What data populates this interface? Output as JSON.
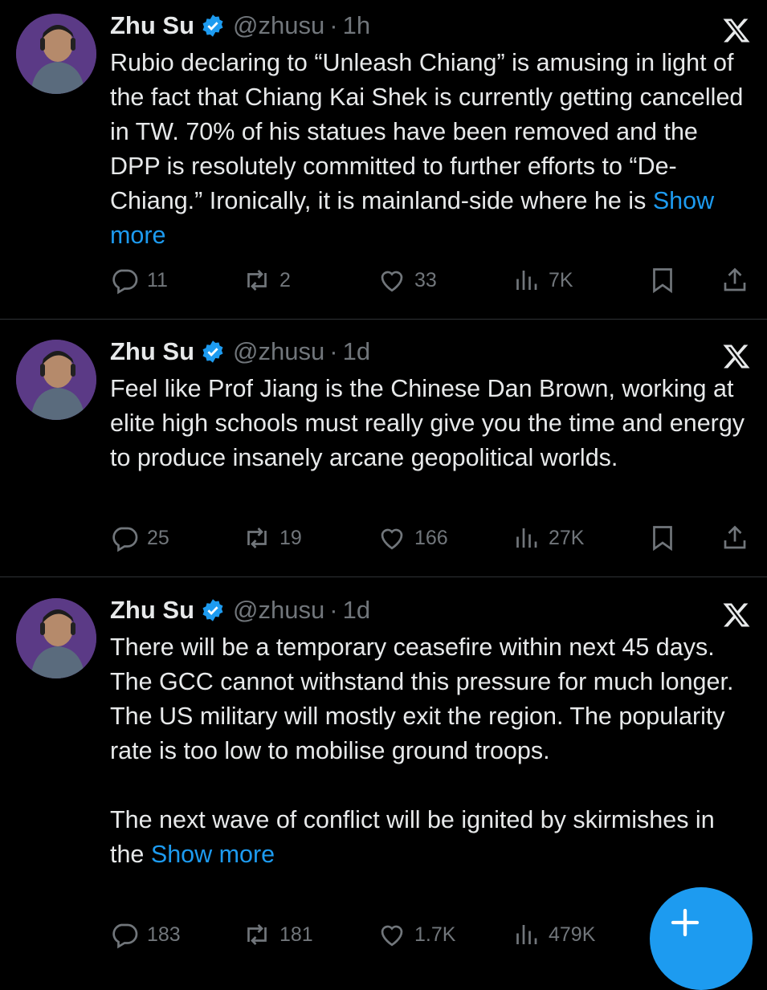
{
  "tweets": [
    {
      "author": "Zhu Su",
      "handle": "@zhusu",
      "separator": "·",
      "time": "1h",
      "text": "Rubio declaring to “Unleash Chiang” is amusing in light of the fact that Chiang Kai Shek is currently getting cancelled in TW. 70% of his statues have been removed and the DPP is resolutely committed to further efforts to “De-Chiang.” Ironically, it is mainland-side where he is ",
      "show_more": "Show more",
      "replies": "11",
      "reposts": "2",
      "likes": "33",
      "views": "7K"
    },
    {
      "author": "Zhu Su",
      "handle": "@zhusu",
      "separator": "·",
      "time": "1d",
      "text": "Feel like Prof Jiang is the Chinese Dan Brown, working at elite high schools must really give you the time and energy to produce insanely arcane geopolitical worlds.",
      "replies": "25",
      "reposts": "19",
      "likes": "166",
      "views": "27K"
    },
    {
      "author": "Zhu Su",
      "handle": "@zhusu",
      "separator": "·",
      "time": "1d",
      "text": "There will be a temporary ceasefire within next 45 days. The GCC cannot withstand this pressure for much longer. The US military will mostly exit the region. The popularity rate is too low to mobilise ground troops.",
      "text2": "The next wave of conflict will be ignited by skirmishes in the ",
      "show_more": "Show more",
      "replies": "183",
      "reposts": "181",
      "likes": "1.7K",
      "views": "479K"
    }
  ],
  "fab_label": "+",
  "colors": {
    "accent": "#1d9bf0",
    "muted": "#71767b",
    "text": "#e7e9ea",
    "divider": "#2f3336"
  },
  "icons": [
    "verified-badge-icon",
    "x-logo-icon",
    "reply-icon",
    "repost-icon",
    "like-icon",
    "views-icon",
    "bookmark-icon",
    "share-icon",
    "compose-icon"
  ]
}
